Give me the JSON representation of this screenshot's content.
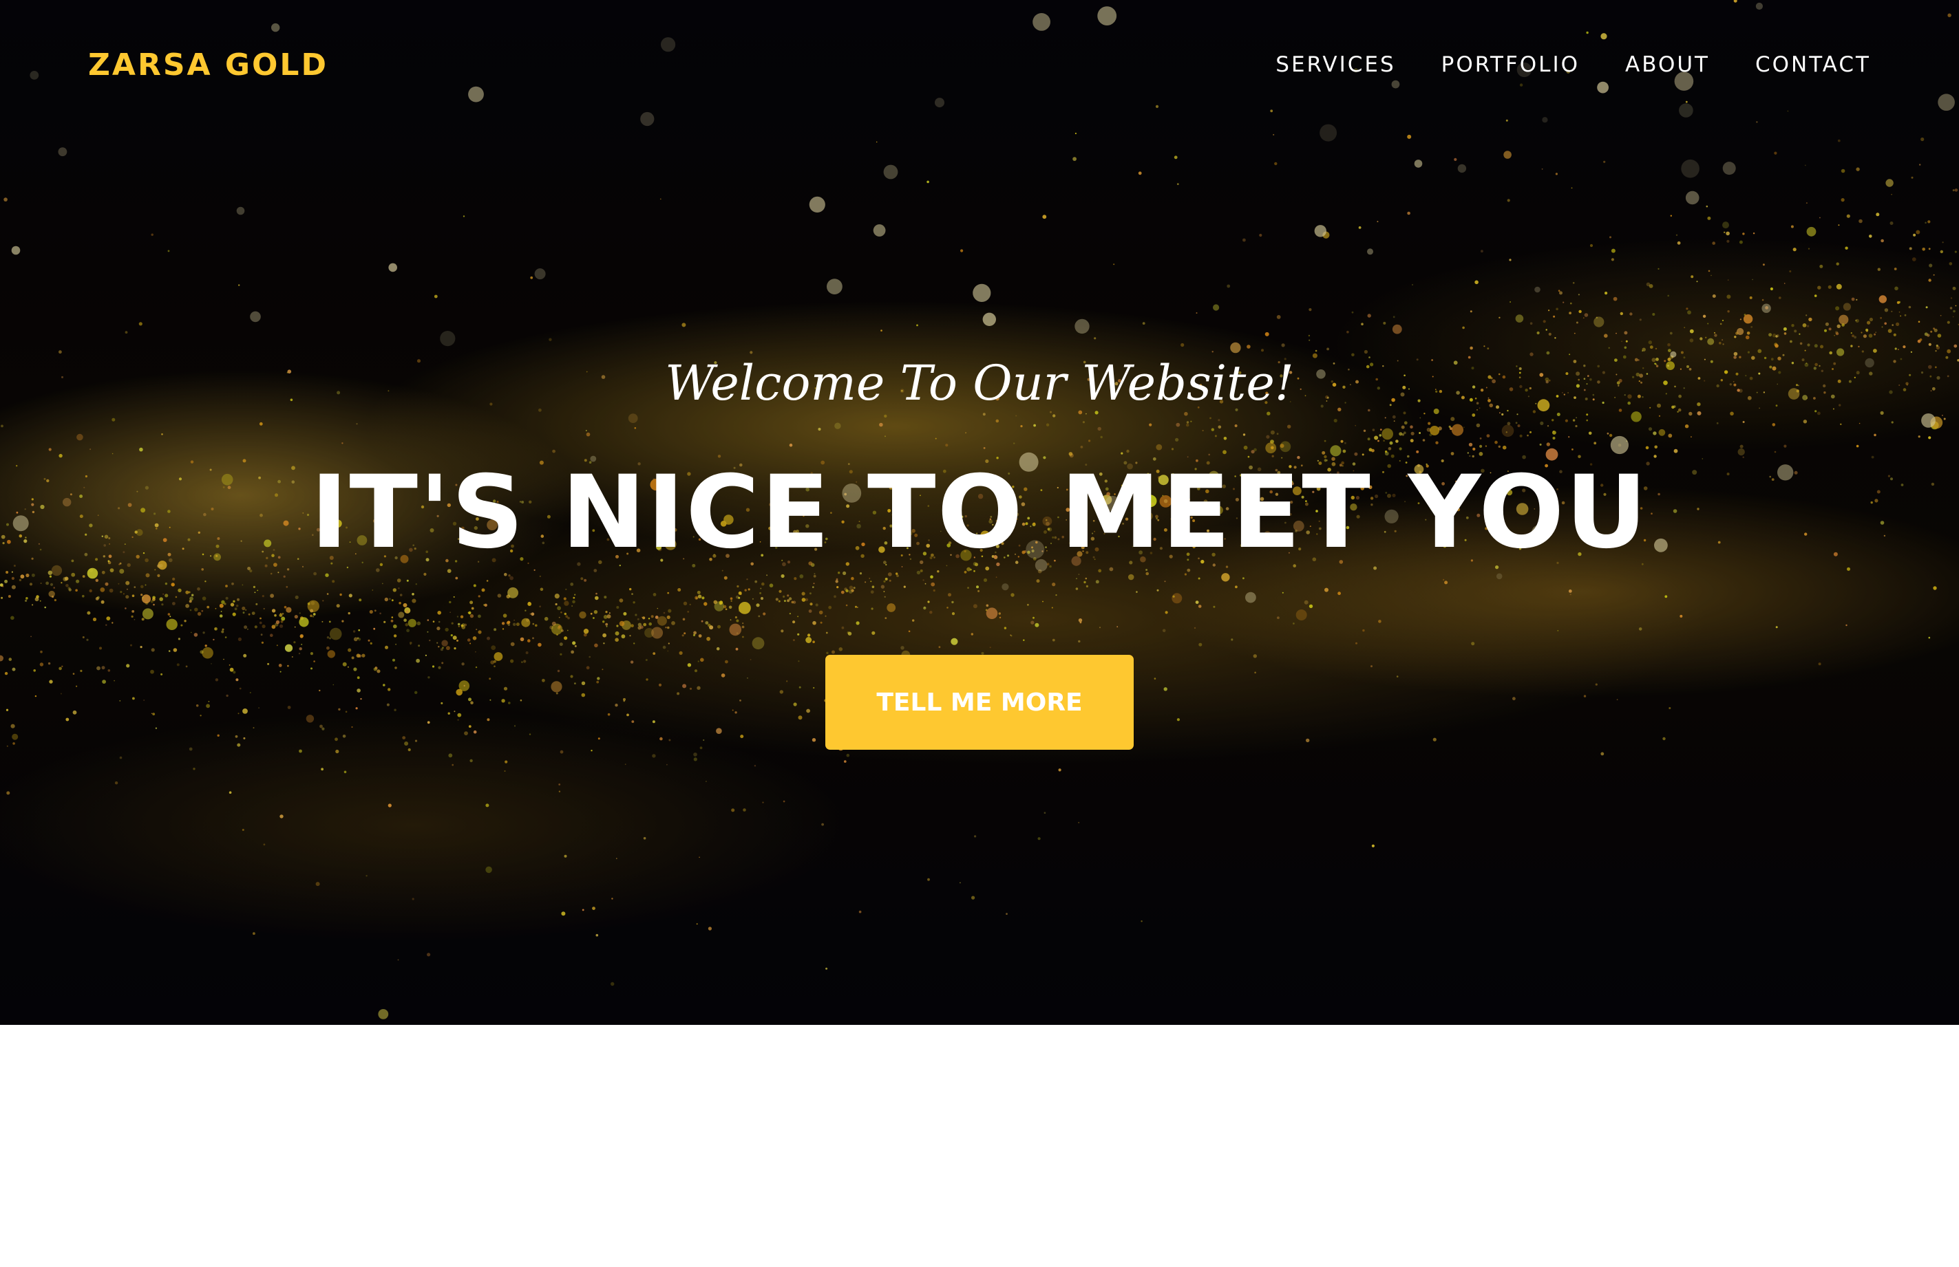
{
  "navbar": {
    "brand": "ZARSA GOLD",
    "links": [
      {
        "label": "SERVICES"
      },
      {
        "label": "PORTFOLIO"
      },
      {
        "label": "ABOUT"
      },
      {
        "label": "CONTACT"
      }
    ]
  },
  "hero": {
    "subheading": "Welcome To Our Website!",
    "heading": "IT'S NICE TO MEET YOU",
    "button_label": "TELL ME MORE"
  },
  "colors": {
    "accent": "#fec830",
    "hero_background": "#05040a",
    "text_light": "#ffffff",
    "page_background": "#ffffff"
  }
}
